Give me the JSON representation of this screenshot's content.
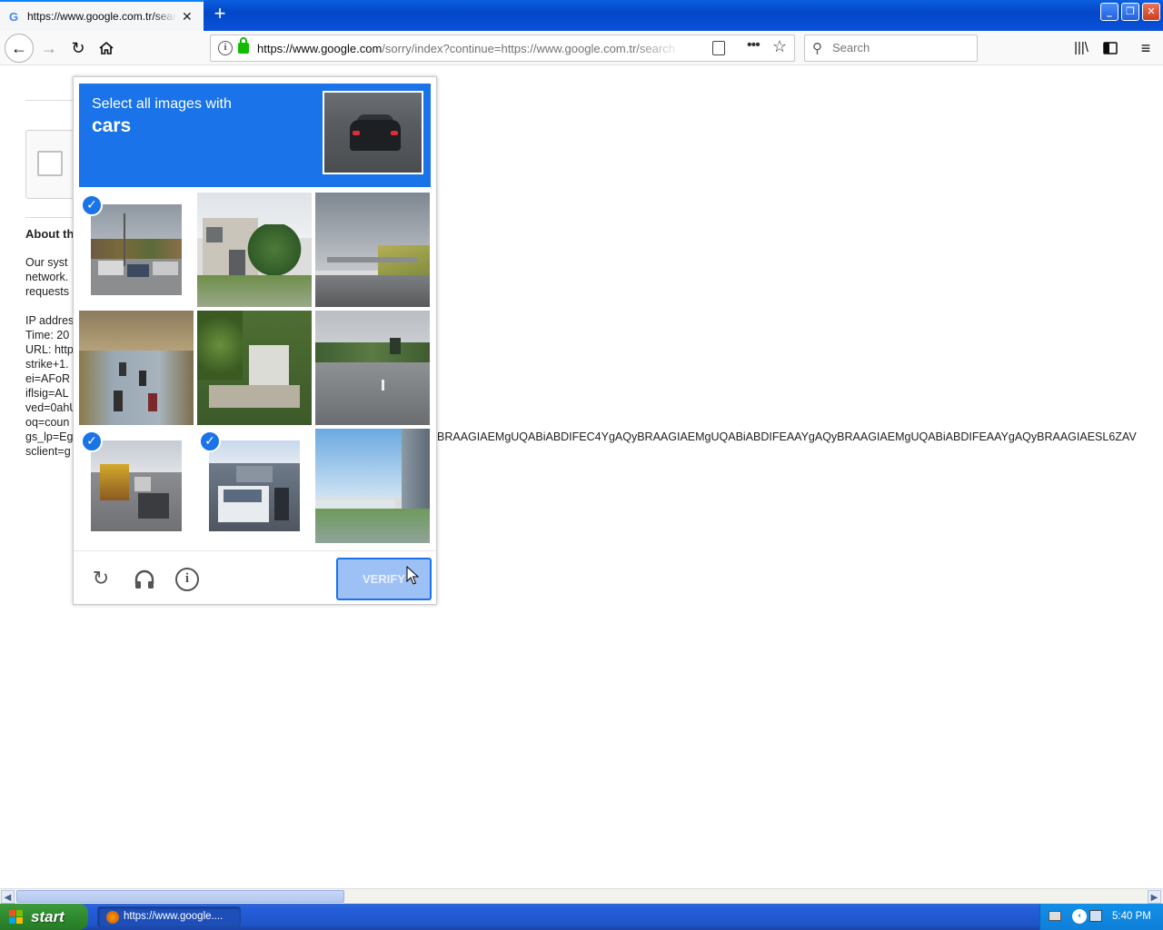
{
  "browser": {
    "tab_title": "https://www.google.com.tr/search",
    "tab_favicon": "G",
    "new_tab": "+",
    "url_domain": "https://www.google.com",
    "url_rest": "/sorry/index?continue=https://www.google.com.tr/search",
    "search_placeholder": "Search",
    "window_buttons": {
      "minimize": "_",
      "maximize": "❐",
      "close": "✕"
    }
  },
  "page": {
    "about_title": "About th",
    "lines": [
      "Our syst",
      "network.",
      "requests",
      "",
      "IP addres",
      "Time: 20",
      "URL: http",
      "strike+1.",
      "ei=AFoR",
      "iflsig=AL",
      "ved=0ahU",
      "oq=coun",
      "gs_lp=Eg",
      "sclient=g"
    ],
    "long_line": "BRAAGIAEMgUQABiABDIFEC4YgAQyBRAAGIAEMgUQABiABDIFEAAYgAQyBRAAGIAEMgUQABiABDIFEAAYgAQyBRAAGIAESL6ZAV"
  },
  "captcha": {
    "instruction": "Select all images with",
    "target": "cars",
    "tiles": [
      {
        "index": 1,
        "scene": "street-trucks-parking",
        "selected": true
      },
      {
        "index": 2,
        "scene": "house-trees",
        "selected": false
      },
      {
        "index": 3,
        "scene": "highway-overpass",
        "selected": false
      },
      {
        "index": 4,
        "scene": "road-motorbikes",
        "selected": false
      },
      {
        "index": 5,
        "scene": "house-hedge",
        "selected": false
      },
      {
        "index": 6,
        "scene": "highway-truck",
        "selected": false
      },
      {
        "index": 7,
        "scene": "highway-traffic-bus",
        "selected": true
      },
      {
        "index": 8,
        "scene": "traffic-jam-white-car",
        "selected": true
      },
      {
        "index": 9,
        "scene": "gas-station-overpass",
        "selected": false
      }
    ],
    "check_mark": "✓",
    "verify_label": "VERIFY",
    "icons": {
      "reload": "reload-icon",
      "audio": "headphones-icon",
      "info": "info-icon"
    }
  },
  "taskbar": {
    "start_label": "start",
    "task_label": "https://www.google....",
    "clock": "5:40 PM"
  },
  "colors": {
    "captcha_blue": "#1a73e8",
    "verify_disabled": "#9ec1f5",
    "xp_taskbar": "#245edb",
    "xp_start": "#2f8a2f"
  }
}
